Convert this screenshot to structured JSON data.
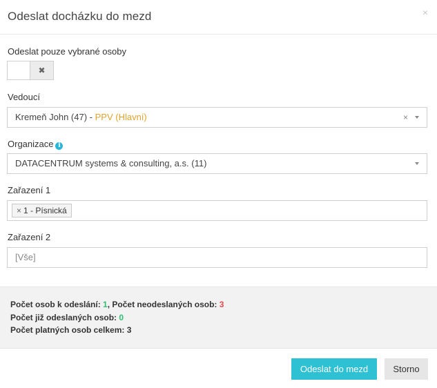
{
  "dialog": {
    "title": "Odeslat docházku do mezd",
    "close_glyph": "×"
  },
  "only_selected": {
    "label": "Odeslat pouze vybrané osoby",
    "toggle_glyph": "✖",
    "state": "off"
  },
  "manager": {
    "label": "Vedoucí",
    "value_name": "Kremeň John (47) - ",
    "value_role": "PPV (Hlavní)",
    "clear_glyph": "×"
  },
  "organization": {
    "label": "Organizace",
    "info_glyph": "i",
    "value": "DATACENTRUM systems & consulting, a.s. (11)"
  },
  "classification1": {
    "label": "Zařazení 1",
    "tags": [
      {
        "remove_glyph": "×",
        "text": "1 - Písnická"
      }
    ]
  },
  "classification2": {
    "label": "Zařazení 2",
    "placeholder": "[Vše]"
  },
  "summary": {
    "to_send_label": "Počet osob k odeslání: ",
    "to_send_value": "1",
    "sep": ", ",
    "not_sent_label": "Počet neodeslaných osob: ",
    "not_sent_value": "3",
    "already_sent_label": "Počet již odeslaných osob: ",
    "already_sent_value": "0",
    "valid_total_label": "Počet platných osob celkem: ",
    "valid_total_value": "3"
  },
  "footer": {
    "submit_label": "Odeslat do mezd",
    "cancel_label": "Storno"
  },
  "colors": {
    "accent": "#2ec1d4",
    "role_highlight": "#e0a32b",
    "positive": "#2fbf71",
    "negative": "#e24b4b",
    "info": "#29b6d8"
  }
}
